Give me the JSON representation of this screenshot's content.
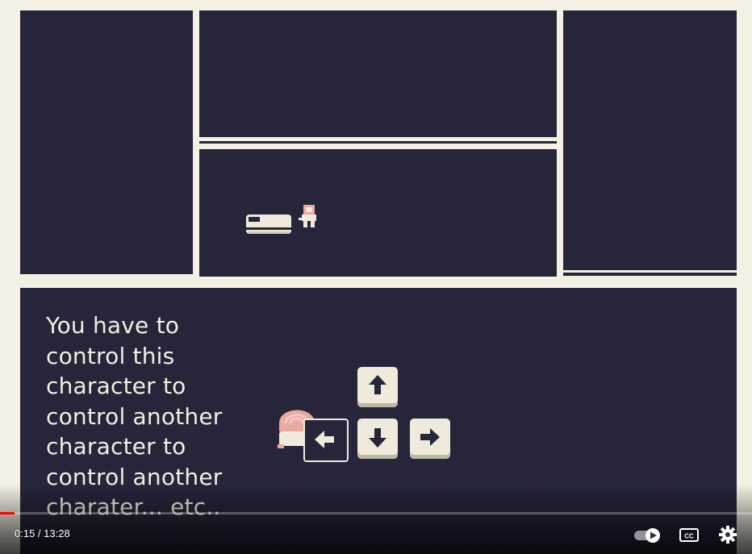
{
  "video": {
    "caption_lines": [
      "You have to",
      "control this",
      "character to",
      "control another",
      "character to",
      "control another",
      "charater... etc.."
    ],
    "player": {
      "current_time": "0:15",
      "separator": " / ",
      "duration": "13:28",
      "progress_fraction": 0.019
    },
    "keys": [
      "arrow-up-key",
      "arrow-left-key",
      "arrow-down-key",
      "arrow-right-key"
    ],
    "colors": {
      "background_cream": "#f4f1e4",
      "panel_navy": "#26253a",
      "key_cream": "#efeadb",
      "character_pink": "#e9a9a3",
      "progress_red": "#ff0000"
    }
  }
}
